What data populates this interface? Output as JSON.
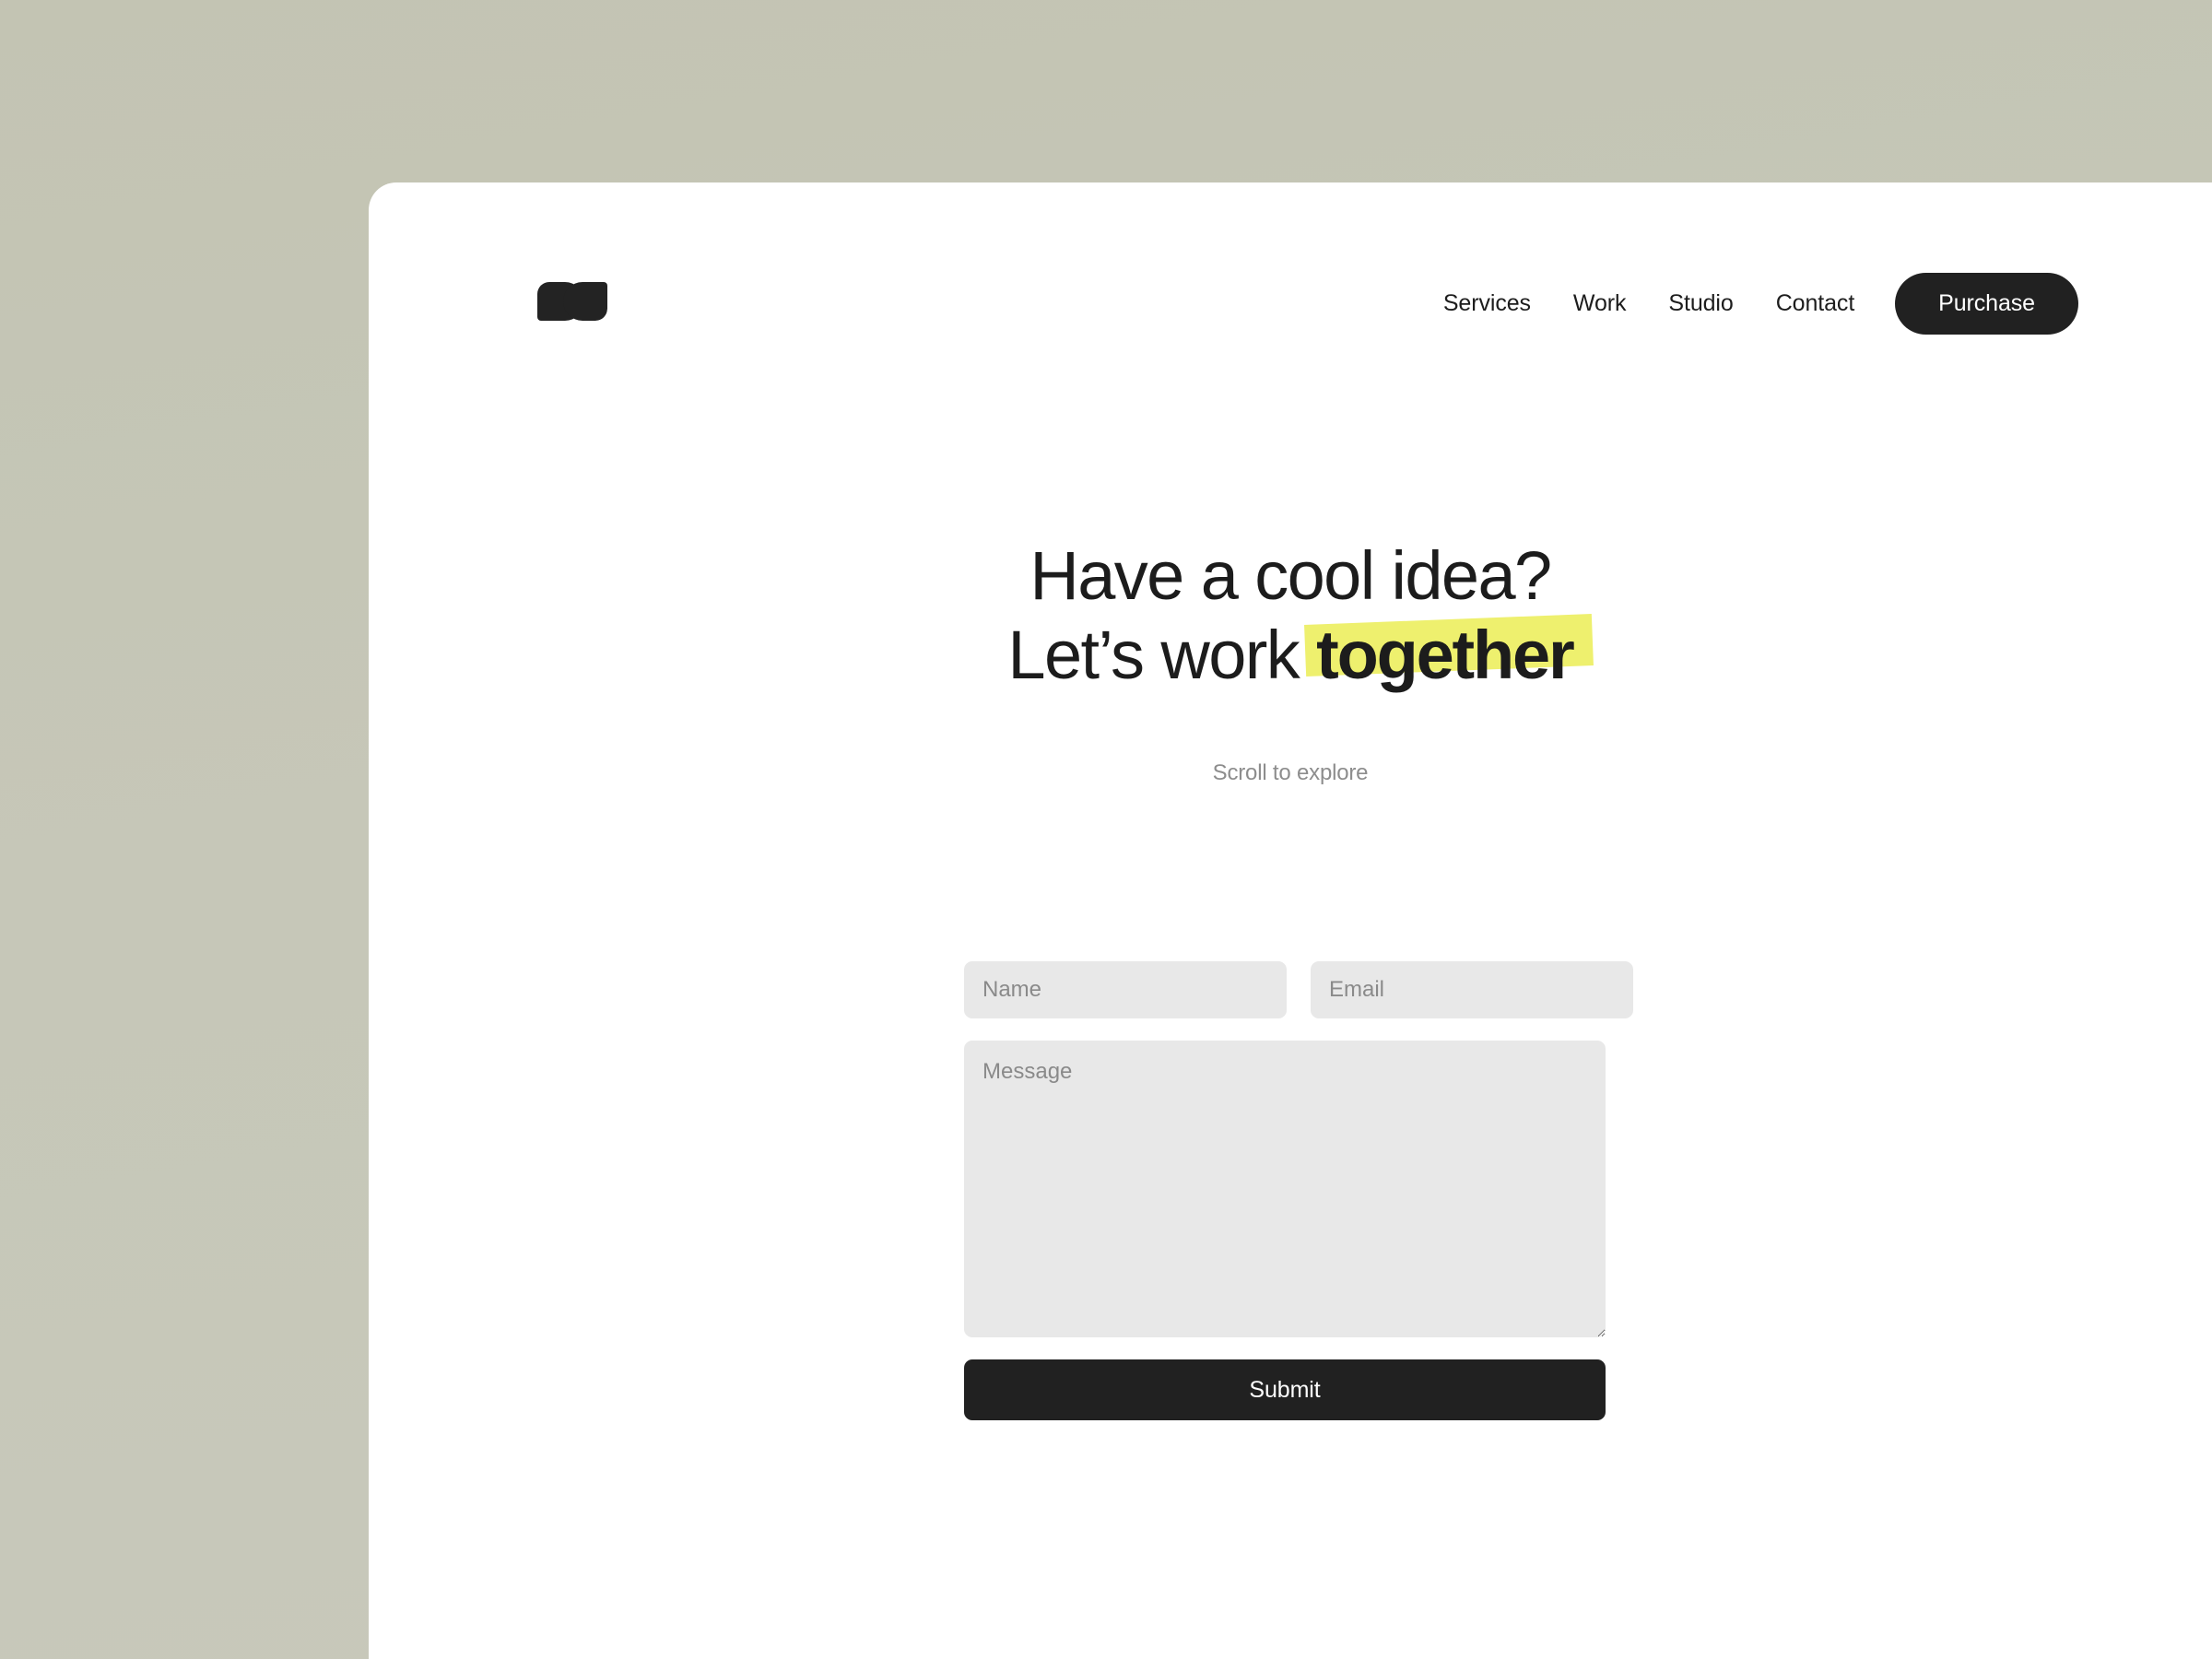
{
  "page": {
    "background_color": "#c5c6b7",
    "panel_color": "#ffffff"
  },
  "header": {
    "logo_name": "studio-logo",
    "nav": [
      {
        "label": "Services"
      },
      {
        "label": "Work"
      },
      {
        "label": "Studio"
      },
      {
        "label": "Contact"
      }
    ],
    "cta": {
      "label": "Purchase",
      "background": "#212121",
      "text_color": "#ffffff"
    }
  },
  "hero": {
    "line1": "Have a cool idea?",
    "line2_prefix": "Let’s work ",
    "line2_highlight": "together",
    "highlight_color": "#eef06e",
    "scroll_hint": "Scroll to explore",
    "text_color": "#1c1c1c",
    "hint_color": "#8d8d8d"
  },
  "form": {
    "name": {
      "placeholder": "Name",
      "value": ""
    },
    "email": {
      "placeholder": "Email",
      "value": ""
    },
    "message": {
      "placeholder": "Message",
      "value": ""
    },
    "submit": {
      "label": "Submit"
    },
    "field_background": "#e8e8e8",
    "placeholder_color": "#8a8a8a"
  }
}
